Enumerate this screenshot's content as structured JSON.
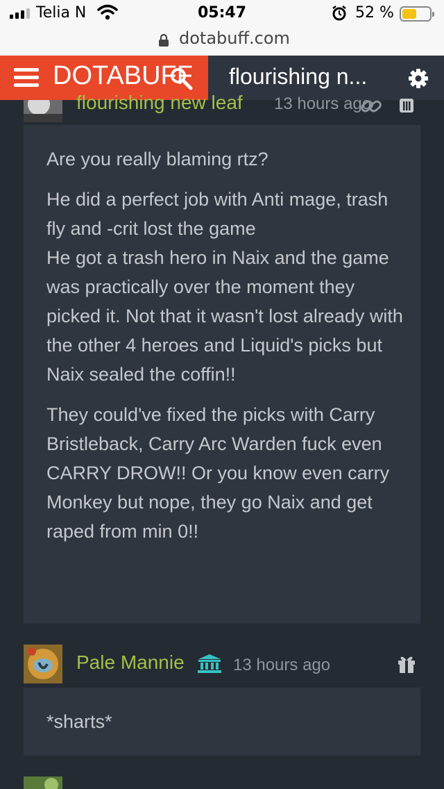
{
  "status_bar": {
    "carrier": "Telia N",
    "time": "05:47",
    "battery": "52 %",
    "battery_level": 0.52
  },
  "browser": {
    "url": "dotabuff.com"
  },
  "header": {
    "logo": "DOTABUFF",
    "title": "flourishing n...",
    "brand_color": "#e8472a"
  },
  "comments": [
    {
      "username": "flourishing new leaf",
      "time": "13 hours ago",
      "paragraphs": [
        "Are you really blaming rtz?",
        "He did a perfect job with Anti mage, trash fly and -crit lost the game\nHe got a trash hero in Naix and the game was practically over the moment they picked it. Not that it wasn't lost already with the other 4 heroes and Liquid's picks but Naix sealed the coffin!!",
        "They could've fixed the picks with Carry Bristleback, Carry Arc Warden fuck even CARRY DROW!! Or you know even carry Monkey but nope, they go Naix and get raped from min 0!!"
      ]
    },
    {
      "username": "Pale Mannie",
      "time": "13 hours ago",
      "paragraphs": [
        "*sharts*"
      ]
    }
  ]
}
